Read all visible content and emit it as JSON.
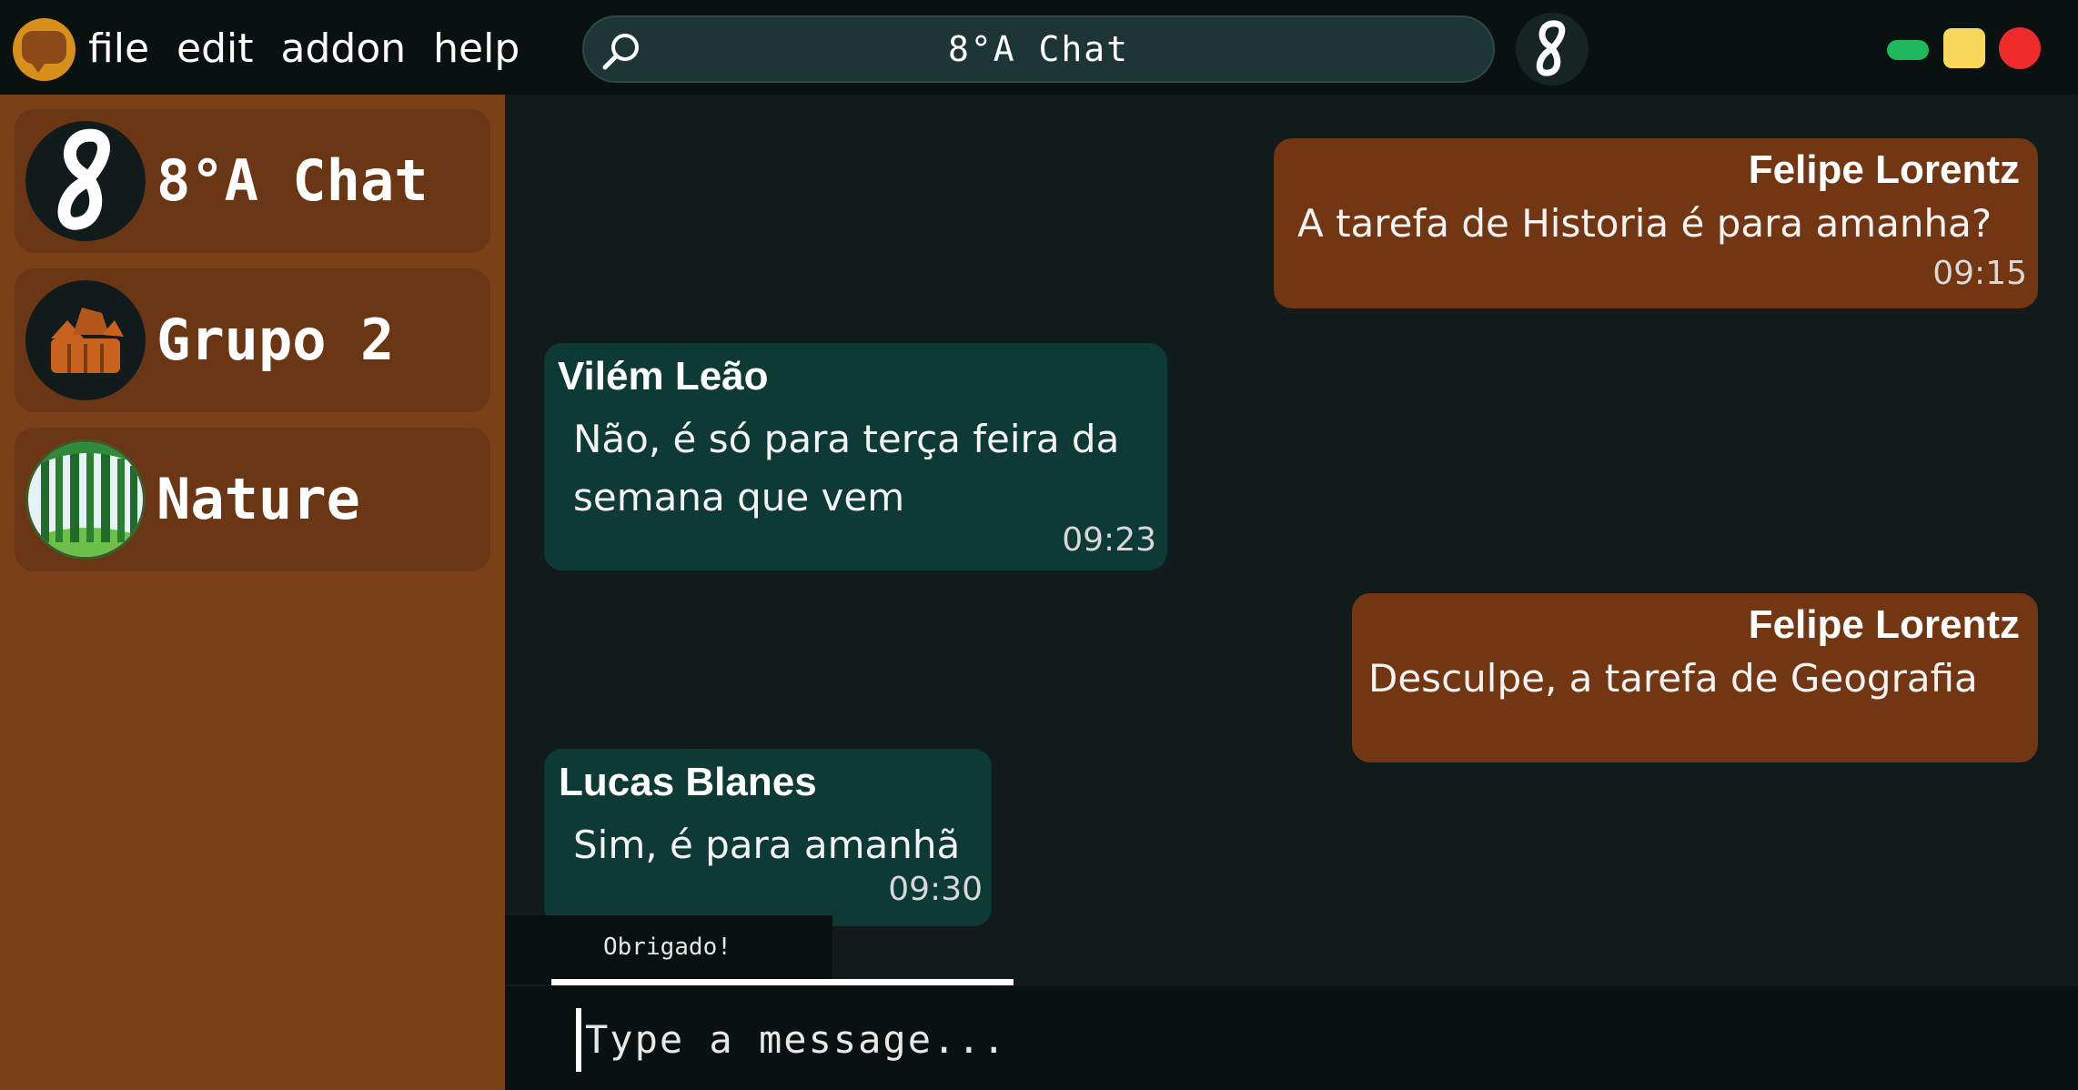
{
  "menu": {
    "items": [
      "file",
      "edit",
      "addon",
      "help"
    ]
  },
  "search": {
    "value": "8°A Chat"
  },
  "sidebar": {
    "chats": [
      {
        "name": "8°A Chat",
        "avatar": "digit-8-logo"
      },
      {
        "name": "Grupo 2",
        "avatar": "group-houses-icon"
      },
      {
        "name": "Nature",
        "avatar": "forest-icon"
      }
    ]
  },
  "messages": [
    {
      "sender": "Felipe Lorentz",
      "text": "A tarefa de Historia é para amanha?",
      "time": "09:15",
      "direction": "sent"
    },
    {
      "sender": "Vilém Leão",
      "text": "Não, é só para terça feira da semana que vem",
      "time": "09:23",
      "direction": "received"
    },
    {
      "sender": "Felipe Lorentz",
      "text": "Desculpe, a tarefa de Geografia",
      "time": "",
      "direction": "sent"
    },
    {
      "sender": "Lucas Blanes",
      "text": "Sim, é para amanhã",
      "time": "09:30",
      "direction": "received"
    }
  ],
  "draft": {
    "preview": "Obrigado!"
  },
  "composer": {
    "placeholder": "Type a message..."
  },
  "colors": {
    "sidebar": "#7a4017",
    "sent_bubble": "#733612",
    "received_bubble": "#0e3a36",
    "background": "#111b1b",
    "minimize": "#1fb85c",
    "maximize": "#f8d75a",
    "close": "#f02b2b"
  }
}
